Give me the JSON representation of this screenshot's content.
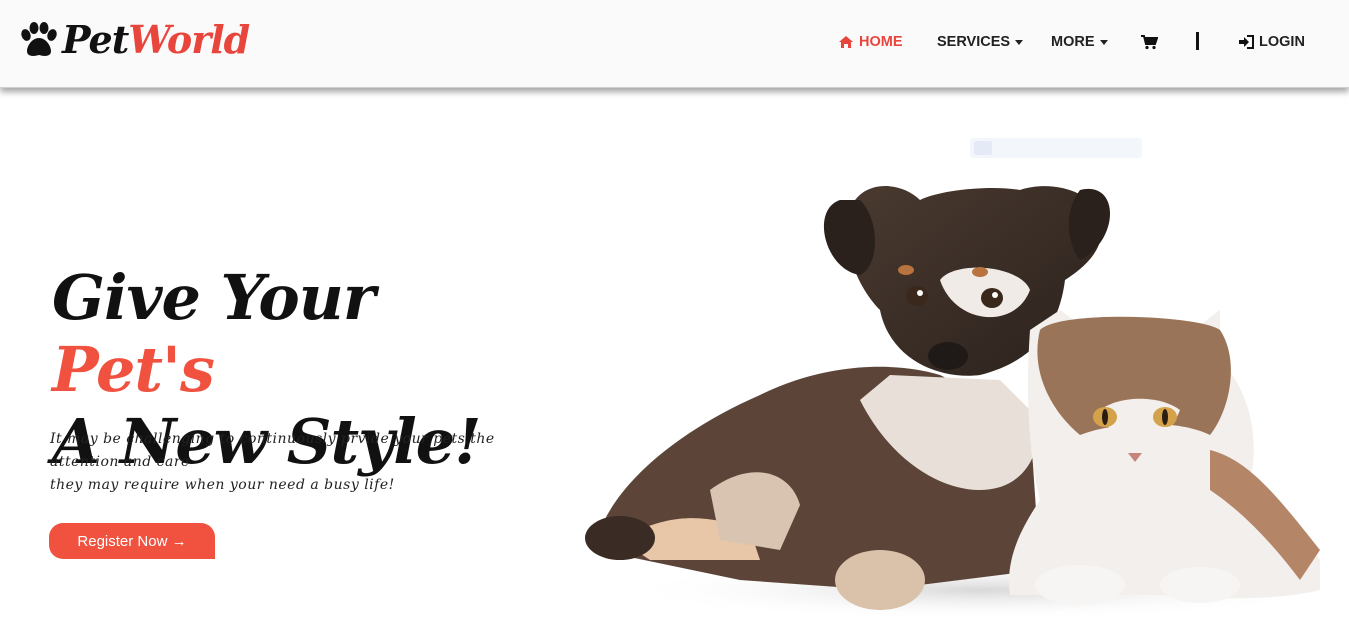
{
  "brand": {
    "name_part1": "Pet",
    "name_part2": "World",
    "accent_color": "#e8453c"
  },
  "nav": {
    "home": "HOME",
    "services": "SERVICES",
    "more": "MORE",
    "login": "LOGIN",
    "active_item": "home"
  },
  "hero": {
    "title_part1": "Give Your ",
    "title_accent": "Pet's",
    "title_line2": "A New Style!",
    "subtitle_line1": "It may be challenging to continuously prvide your pets the attention and care",
    "subtitle_line2": "they may require when your need a busy life!",
    "cta_label": "Register Now →",
    "cta_color": "#f0523f"
  },
  "icons": [
    "paw-icon",
    "home-icon",
    "caret-down-icon",
    "cart-icon",
    "login-icon"
  ]
}
